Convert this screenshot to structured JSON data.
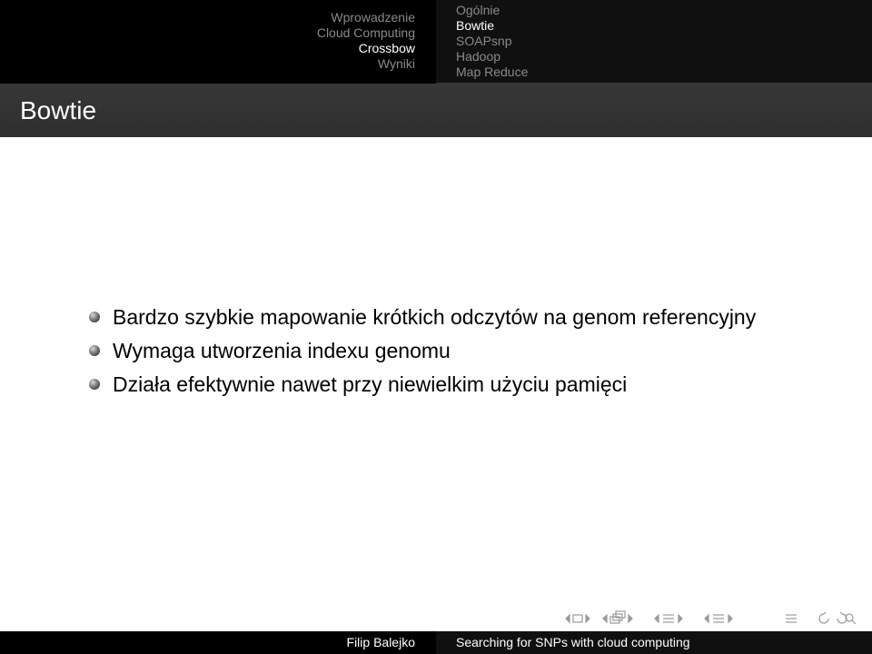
{
  "nav": {
    "sections": [
      {
        "label": "Wprowadzenie",
        "active": false
      },
      {
        "label": "Cloud Computing",
        "active": false
      },
      {
        "label": "Crossbow",
        "active": true
      },
      {
        "label": "Wyniki",
        "active": false
      }
    ],
    "subsections": [
      {
        "label": "Ogólnie",
        "active": false
      },
      {
        "label": "Bowtie",
        "active": true
      },
      {
        "label": "SOAPsnp",
        "active": false
      },
      {
        "label": "Hadoop",
        "active": false
      },
      {
        "label": "Map Reduce",
        "active": false
      }
    ]
  },
  "frame": {
    "title": "Bowtie",
    "bullets": [
      "Bardzo szybkie mapowanie krótkich odczytów na genom referencyjny",
      "Wymaga utworzenia indexu genomu",
      "Działa efektywnie nawet przy niewielkim użyciu pamięci"
    ]
  },
  "navigation_symbols": [
    "slide-nav-icon",
    "frame-nav-icon",
    "subsection-nav-icon",
    "section-nav-icon",
    "doc-nav-icon",
    "search-zoom-icon"
  ],
  "footer": {
    "author": "Filip Balejko",
    "talk_title": "Searching for SNPs with cloud computing"
  },
  "colors": {
    "header_bg": "#000000",
    "title_bg": "#333333",
    "active_text": "#ffffff",
    "inactive_text": "#8a8a8a"
  }
}
